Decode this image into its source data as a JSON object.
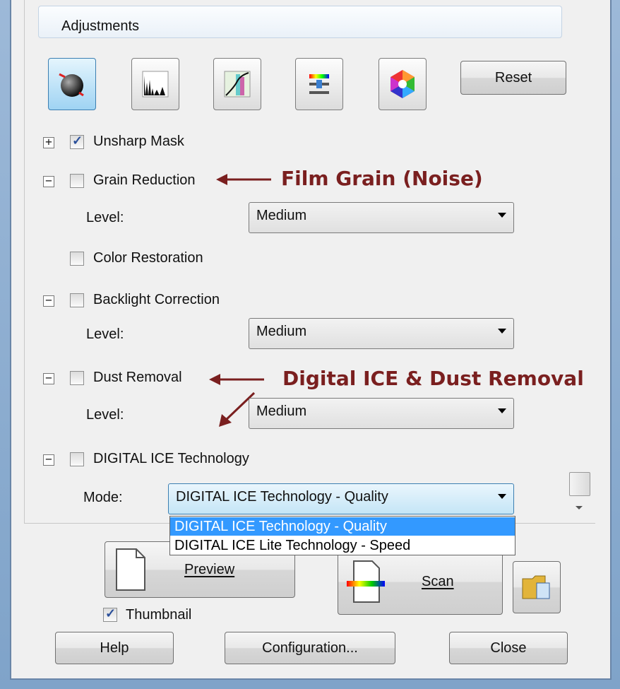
{
  "adjustments": {
    "header": "Adjustments",
    "toolbar": {
      "buttons": [
        {
          "name": "auto-exposure-icon",
          "active": true
        },
        {
          "name": "histogram-icon",
          "active": false
        },
        {
          "name": "tone-curve-icon",
          "active": false
        },
        {
          "name": "color-balance-icon",
          "active": false
        },
        {
          "name": "color-palette-icon",
          "active": false
        }
      ],
      "reset_label": "Reset"
    },
    "items": {
      "unsharp_mask": {
        "label": "Unsharp Mask",
        "checked": true,
        "expander": "+"
      },
      "grain_reduction": {
        "label": "Grain Reduction",
        "checked": false,
        "expander": "−",
        "level_label": "Level:",
        "level_value": "Medium"
      },
      "color_restoration": {
        "label": "Color Restoration",
        "checked": false
      },
      "backlight_correction": {
        "label": "Backlight Correction",
        "checked": false,
        "expander": "−",
        "level_label": "Level:",
        "level_value": "Medium"
      },
      "dust_removal": {
        "label": "Dust Removal",
        "checked": false,
        "expander": "−",
        "level_label": "Level:",
        "level_value": "Medium"
      },
      "digital_ice": {
        "label": "DIGITAL ICE Technology",
        "checked": false,
        "expander": "−",
        "mode_label": "Mode:",
        "mode_value": "DIGITAL ICE Technology - Quality"
      }
    },
    "mode_options": [
      "DIGITAL ICE Technology - Quality",
      "DIGITAL ICE Lite Technology - Speed"
    ]
  },
  "annotations": {
    "film_grain": "Film Grain (Noise)",
    "digital_ice": "Digital ICE & Dust Removal"
  },
  "actions": {
    "preview_label": "Preview",
    "scan_label": "Scan",
    "thumbnail_label": "Thumbnail",
    "thumbnail_checked": true,
    "help_label": "Help",
    "configuration_label": "Configuration...",
    "close_label": "Close"
  },
  "colors": {
    "annotation": "#7a1f1f",
    "selection": "#3399ff"
  }
}
